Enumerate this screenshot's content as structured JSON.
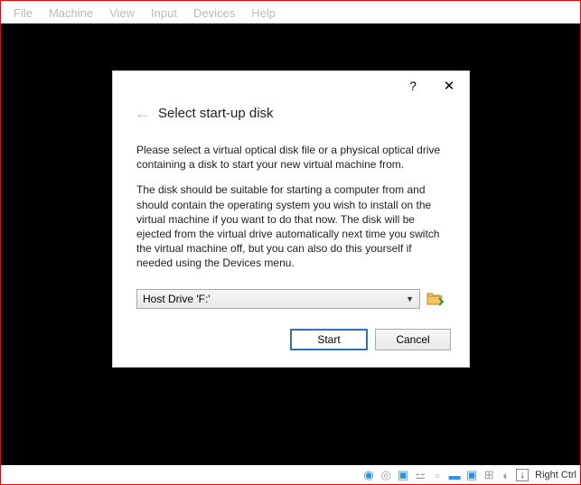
{
  "menu": {
    "file": "File",
    "machine": "Machine",
    "view": "View",
    "input": "Input",
    "devices": "Devices",
    "help": "Help"
  },
  "dialog": {
    "help_label": "?",
    "close_label": "✕",
    "back_glyph": "←",
    "title": "Select start-up disk",
    "para1": "Please select a virtual optical disk file or a physical optical drive containing a disk to start your new virtual machine from.",
    "para2": "The disk should be suitable for starting a computer from and should contain the operating system you wish to install on the virtual machine if you want to do that now. The disk will be ejected from the virtual drive automatically next time you switch the virtual machine off, but you can also do this yourself if needed using the Devices menu.",
    "drive_selected": "Host Drive 'F:'",
    "start_label": "Start",
    "cancel_label": "Cancel"
  },
  "status": {
    "hostkey": "Right Ctrl",
    "capture_glyph": "↓"
  }
}
